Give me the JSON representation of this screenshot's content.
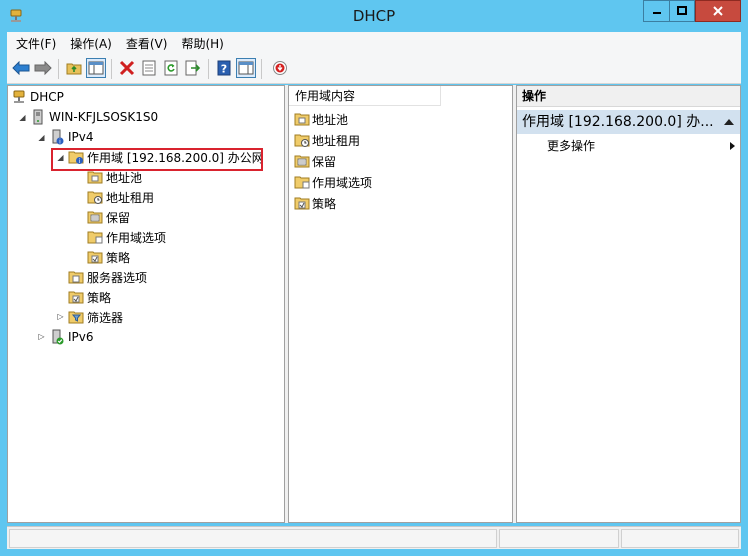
{
  "window": {
    "title": "DHCP",
    "colors": {
      "frame": "#5fc6f0",
      "close": "#c74a3e",
      "highlight": "#d9232e",
      "selection": "#d2e1ef"
    }
  },
  "menu": [
    {
      "label": "文件(F)"
    },
    {
      "label": "操作(A)"
    },
    {
      "label": "查看(V)"
    },
    {
      "label": "帮助(H)"
    }
  ],
  "toolbar": {
    "icons": [
      "back-arrow-icon",
      "forward-arrow-icon",
      "up-folder-icon",
      "console-tree-icon",
      "delete-icon",
      "properties-icon",
      "refresh-icon",
      "export-icon",
      "help-icon",
      "action-pane-icon",
      "deactivate-icon"
    ]
  },
  "tree": {
    "root": "DHCP",
    "server": "WIN-KFJLSOSK1S0",
    "ipv4": "IPv4",
    "scope": "作用域 [192.168.200.0] 办公网",
    "scope_children": [
      "地址池",
      "地址租用",
      "保留",
      "作用域选项",
      "策略"
    ],
    "server_options": "服务器选项",
    "policies": "策略",
    "filters": "筛选器",
    "ipv6": "IPv6"
  },
  "list": {
    "column_header": "作用域内容",
    "items": [
      "地址池",
      "地址租用",
      "保留",
      "作用域选项",
      "策略"
    ]
  },
  "actions": {
    "header": "操作",
    "group": "作用域 [192.168.200.0] 办...",
    "more": "更多操作"
  }
}
